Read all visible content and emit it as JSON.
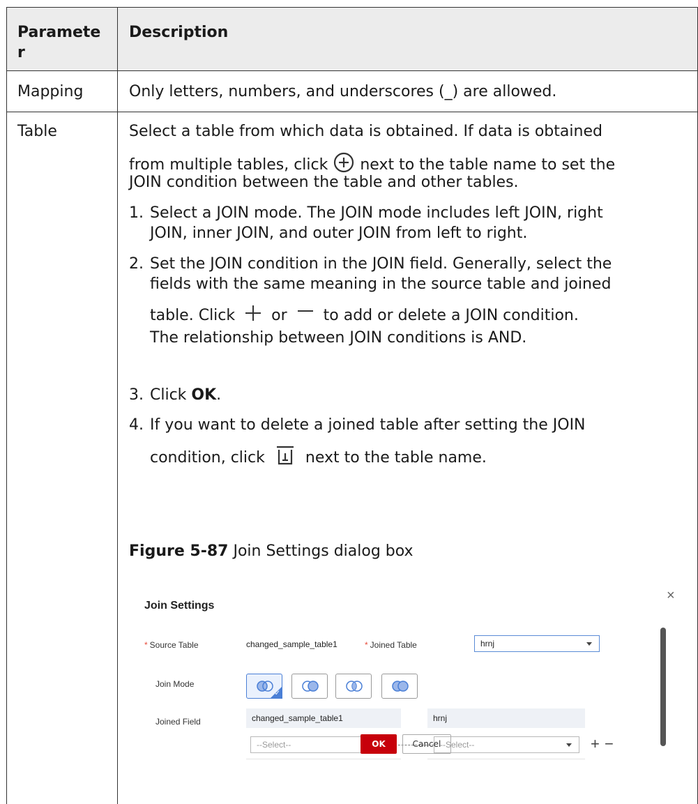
{
  "table": {
    "header": {
      "param": "Paramete\nr",
      "param_line1": "Paramete",
      "param_line2": "r",
      "desc": "Description"
    },
    "rows": [
      {
        "param": "Mapping",
        "desc": "Only letters, numbers, and underscores (_) are allowed."
      },
      {
        "param": "Table"
      }
    ]
  },
  "table_row": {
    "intro_line1": "Select a table from which data is obtained. If data is obtained",
    "intro_line2_a": "from multiple tables, click",
    "intro_line2_b": "next to the table name to set the",
    "intro_line3": "JOIN condition between the table and other tables.",
    "step1_num": "1.",
    "step1_line1": "Select a JOIN mode. The JOIN mode includes left JOIN, right",
    "step1_line2": "JOIN, inner JOIN, and outer JOIN from left to right.",
    "step2_num": "2.",
    "step2_line1": "Set the JOIN condition in the JOIN field. Generally, select the",
    "step2_line2": "fields with the same meaning in the source table and joined",
    "step2_line3_a": "table. Click",
    "step2_line3_or": "or",
    "step2_line3_b": "to add or delete a JOIN condition.",
    "step2_line4": "The relationship between JOIN conditions is AND.",
    "step3_num": "3.",
    "step3_a": "Click",
    "step3_bold": "OK",
    "step3_b": ".",
    "step4_num": "4.",
    "step4_line1": "If you want to delete a joined table after setting the JOIN",
    "step4_line2_a": "condition, click",
    "step4_line2_b": "next to the table name.",
    "fig_label": "Figure 5-87",
    "fig_title": "Join Settings dialog box"
  },
  "dialog": {
    "title": "Join Settings",
    "close": "×",
    "source_table_label": "Source Table",
    "source_table_value": "changed_sample_table1",
    "joined_table_label": "Joined Table",
    "joined_table_value": "hrnj",
    "join_mode_label": "Join Mode",
    "joined_field_label": "Joined Field",
    "field_left_header": "changed_sample_table1",
    "field_right_header": "hrnj",
    "select_placeholder_left": "--Select--",
    "select_placeholder_right": "--Select--",
    "plus": "+",
    "minus": "−",
    "ok": "OK",
    "cancel": "Cancel"
  },
  "icons": [
    "add-circle-icon",
    "plus-icon",
    "minus-icon",
    "trash-icon",
    "close-icon",
    "left-join-icon",
    "right-join-icon",
    "inner-join-icon",
    "outer-join-icon",
    "caret-down-icon"
  ],
  "colors": {
    "header_bg": "#ececec",
    "ok_button": "#c7000b",
    "required": "#e74c3c",
    "selected_mode": "#4a7fd6"
  }
}
